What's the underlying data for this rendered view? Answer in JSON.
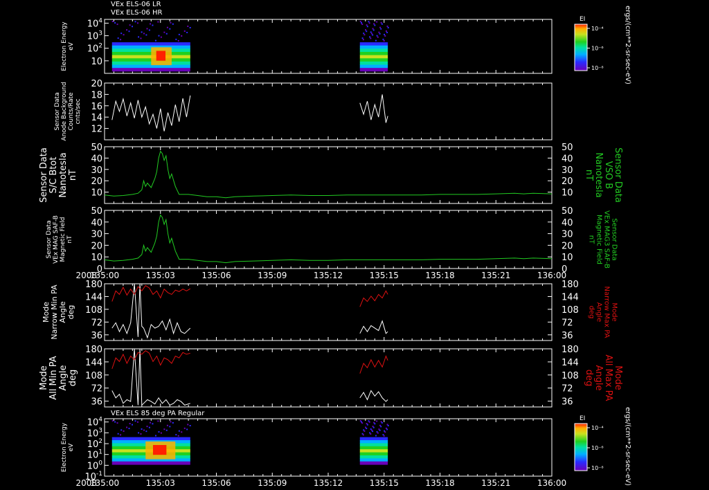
{
  "header": {
    "line1": "VEx ELS-06 LR",
    "line2": "VEx ELS-06 HR",
    "panel7_title": "VEx ELS 85 deg PA Regular"
  },
  "colorbar": {
    "label": "EI",
    "ticks": [
      "10⁻⁴",
      "10⁻⁶",
      "10⁻⁸"
    ],
    "units": "ergs/(cm**2-sr-sec-eV)"
  },
  "time_axis": {
    "year": "2008",
    "ticks": [
      "135:00",
      "135:03",
      "135:06",
      "135:09",
      "135:12",
      "135:15",
      "135:18",
      "135:21",
      "136:00"
    ]
  },
  "colors": {
    "background": "#000000",
    "axis": "#ffffff",
    "white_trace": "#ffffff",
    "green_trace": "#22cc22",
    "red_trace": "#dd1111",
    "spectrogram_palette": [
      "#6a00b8",
      "#2a2aff",
      "#00b0ff",
      "#00e0a0",
      "#20d020",
      "#c8e020",
      "#ffb000",
      "#ff2000"
    ]
  },
  "chart_data": [
    {
      "type": "heatmap",
      "panel": 1,
      "ylabel_lines": [
        "Electron Energy",
        "eV"
      ],
      "yscale": "log",
      "ylim": [
        1,
        20000
      ],
      "ytick_labels": [
        {
          "value": 10,
          "mant": "10",
          "exp": ""
        },
        {
          "value": 100,
          "mant": "10",
          "exp": "2"
        },
        {
          "value": 1000,
          "mant": "10",
          "exp": "3"
        },
        {
          "value": 10000,
          "mant": "10",
          "exp": "4"
        }
      ],
      "data_intervals_min": [
        [
          0.4,
          4.6
        ],
        [
          13.7,
          15.2
        ]
      ],
      "peak_intervals_min": [
        [
          2.5,
          3.6
        ]
      ]
    },
    {
      "type": "line",
      "panel": 2,
      "ylabel_lines": [
        "Sensor Data",
        "Anode Background",
        "Counts/Rate",
        "cnts/sec"
      ],
      "ylim": [
        10,
        20
      ],
      "yticks": [
        12,
        14,
        16,
        18,
        20
      ],
      "series": [
        {
          "color": "white",
          "segments": [
            {
              "x": [
                0.4,
                0.6,
                0.8,
                1.0,
                1.2,
                1.4,
                1.6,
                1.8,
                2.0,
                2.2,
                2.4,
                2.6,
                2.8,
                3.0,
                3.2,
                3.4,
                3.6,
                3.8,
                4.0,
                4.2,
                4.4,
                4.6
              ],
              "y": [
                13.5,
                16.8,
                15.0,
                17.2,
                14.2,
                16.5,
                13.8,
                17.0,
                14.0,
                15.8,
                12.8,
                14.5,
                12.0,
                15.5,
                11.5,
                14.8,
                12.5,
                16.2,
                13.2,
                17.3,
                14.0,
                17.8
              ]
            },
            {
              "x": [
                13.7,
                13.9,
                14.1,
                14.3,
                14.5,
                14.7,
                14.9,
                15.1,
                15.2
              ],
              "y": [
                16.5,
                14.5,
                16.8,
                13.5,
                16.2,
                14.0,
                18.0,
                13.0,
                14.2
              ]
            }
          ]
        }
      ]
    },
    {
      "type": "line",
      "panel": 3,
      "ylabel_lines": [
        "Sensor Data",
        "S/C Btot",
        "Nanotesla",
        "nT"
      ],
      "ylabel_right_lines": [
        "Sensor Data",
        "VSO B",
        "Nanotesla",
        "nT"
      ],
      "ylim": [
        0,
        50
      ],
      "yticks": [
        10,
        20,
        30,
        40,
        50
      ],
      "series": [
        {
          "color": "green",
          "segments": [
            {
              "x": [
                0,
                0.5,
                1.0,
                1.5,
                1.8,
                2.0,
                2.1,
                2.2,
                2.3,
                2.5,
                2.7,
                2.8,
                2.9,
                3.0,
                3.1,
                3.2,
                3.3,
                3.4,
                3.5,
                3.6,
                3.8,
                4.0,
                4.5,
                5.0,
                5.5,
                6.0,
                6.5,
                7.0,
                8.0,
                9.0,
                10,
                11,
                12,
                13,
                14,
                15,
                16,
                17,
                18,
                19,
                20,
                21,
                22,
                22.5,
                23,
                24
              ],
              "y": [
                7.5,
                6.5,
                7.0,
                8.0,
                9.0,
                12,
                20,
                15,
                18,
                14,
                22,
                28,
                40,
                46,
                44,
                38,
                42,
                30,
                22,
                26,
                15,
                8,
                8,
                7,
                6,
                6,
                5,
                6,
                6.5,
                7,
                7.5,
                7,
                7,
                7.5,
                7.5,
                7.5,
                7.5,
                7.5,
                8,
                8,
                8,
                8.5,
                9,
                8.5,
                9,
                8.5
              ]
            }
          ]
        }
      ]
    },
    {
      "type": "line",
      "panel": 4,
      "ylabel_lines": [
        "Sensor Data",
        "VEx MAG SAF-B",
        "Magnetic Field",
        "nT"
      ],
      "ylabel_right_lines": [
        "Sensor Data",
        "VEx MAG3 SAF-B",
        "Magnetic Field",
        "nT"
      ],
      "ylim": [
        0,
        50
      ],
      "yticks": [
        0,
        10,
        20,
        30,
        40,
        50
      ],
      "series": [
        {
          "color": "green",
          "segments": [
            {
              "x": [
                0,
                0.5,
                1.0,
                1.5,
                1.8,
                2.0,
                2.1,
                2.2,
                2.3,
                2.5,
                2.7,
                2.8,
                2.9,
                3.0,
                3.1,
                3.2,
                3.3,
                3.4,
                3.5,
                3.6,
                3.8,
                4.0,
                4.5,
                5.0,
                5.5,
                6.0,
                6.5,
                7.0,
                8.0,
                9.0,
                10,
                11,
                12,
                13,
                14,
                15,
                16,
                17,
                18,
                19,
                20,
                21,
                22,
                22.5,
                23,
                24
              ],
              "y": [
                7.5,
                6.5,
                7.0,
                8.0,
                9.0,
                12,
                20,
                15,
                18,
                14,
                22,
                28,
                40,
                46,
                44,
                38,
                42,
                30,
                22,
                26,
                15,
                8,
                8,
                7,
                6,
                6,
                5,
                6,
                6.5,
                7,
                7.5,
                7,
                7,
                7.5,
                7.5,
                7.5,
                7.5,
                7.5,
                8,
                8,
                8,
                8.5,
                9,
                8.5,
                9,
                8.5
              ]
            }
          ]
        }
      ]
    },
    {
      "type": "line",
      "panel": 5,
      "ylabel_lines": [
        "Mode",
        "Narrow Min PA",
        "Angle",
        "deg"
      ],
      "ylabel_right_lines": [
        "Mode",
        "Narrow Max PA",
        "Angle",
        "deg"
      ],
      "ylim": [
        20,
        180
      ],
      "yticks": [
        36,
        72,
        108,
        144,
        180
      ],
      "series": [
        {
          "color": "white",
          "segments": [
            {
              "x": [
                0.4,
                0.6,
                0.8,
                1.0,
                1.2,
                1.4,
                1.6,
                1.8,
                1.9,
                2.0,
                2.1,
                2.3,
                2.5,
                2.7,
                2.9,
                3.1,
                3.3,
                3.5,
                3.7,
                3.9,
                4.1,
                4.3,
                4.6
              ],
              "y": [
                55,
                70,
                45,
                65,
                40,
                70,
                180,
                30,
                180,
                60,
                55,
                28,
                65,
                55,
                60,
                75,
                50,
                80,
                40,
                70,
                45,
                40,
                55
              ]
            },
            {
              "x": [
                13.7,
                13.9,
                14.1,
                14.3,
                14.5,
                14.7,
                14.9,
                15.1,
                15.2
              ],
              "y": [
                40,
                60,
                45,
                62,
                55,
                48,
                75,
                40,
                45
              ]
            }
          ]
        },
        {
          "color": "red",
          "segments": [
            {
              "x": [
                0.4,
                0.6,
                0.8,
                1.0,
                1.2,
                1.4,
                1.6,
                1.8,
                2.0,
                2.2,
                2.4,
                2.6,
                2.8,
                3.0,
                3.2,
                3.4,
                3.6,
                3.8,
                4.0,
                4.2,
                4.4,
                4.6
              ],
              "y": [
                130,
                160,
                150,
                170,
                148,
                165,
                150,
                172,
                160,
                175,
                168,
                150,
                160,
                140,
                165,
                155,
                150,
                162,
                158,
                165,
                160,
                166
              ]
            },
            {
              "x": [
                13.7,
                13.9,
                14.1,
                14.3,
                14.5,
                14.7,
                14.9,
                15.1,
                15.2
              ],
              "y": [
                115,
                140,
                130,
                145,
                132,
                150,
                140,
                160,
                150
              ]
            }
          ]
        }
      ]
    },
    {
      "type": "line",
      "panel": 6,
      "ylabel_lines": [
        "Mode",
        "All Min PA",
        "Angle",
        "deg"
      ],
      "ylabel_right_lines": [
        "Mode",
        "All Max PA",
        "Angle",
        "deg"
      ],
      "ylim": [
        20,
        180
      ],
      "yticks": [
        36,
        72,
        108,
        144,
        180
      ],
      "series": [
        {
          "color": "white",
          "segments": [
            {
              "x": [
                0.4,
                0.6,
                0.8,
                1.0,
                1.2,
                1.4,
                1.6,
                1.8,
                1.9,
                2.0,
                2.1,
                2.3,
                2.5,
                2.7,
                2.9,
                3.1,
                3.3,
                3.5,
                3.7,
                3.9,
                4.1,
                4.3,
                4.6
              ],
              "y": [
                65,
                45,
                55,
                30,
                40,
                35,
                180,
                25,
                180,
                25,
                30,
                40,
                35,
                28,
                45,
                30,
                40,
                25,
                30,
                40,
                35,
                25,
                30
              ]
            },
            {
              "x": [
                13.7,
                13.9,
                14.1,
                14.3,
                14.5,
                14.7,
                14.9,
                15.1,
                15.2
              ],
              "y": [
                45,
                60,
                40,
                65,
                50,
                62,
                45,
                35,
                40
              ]
            }
          ]
        },
        {
          "color": "red",
          "segments": [
            {
              "x": [
                0.4,
                0.6,
                0.8,
                1.0,
                1.2,
                1.4,
                1.6,
                1.8,
                2.0,
                2.2,
                2.4,
                2.6,
                2.8,
                3.0,
                3.2,
                3.4,
                3.6,
                3.8,
                4.0,
                4.2,
                4.4,
                4.6
              ],
              "y": [
                125,
                155,
                145,
                165,
                140,
                160,
                150,
                170,
                165,
                175,
                168,
                145,
                160,
                135,
                155,
                150,
                140,
                160,
                155,
                170,
                165,
                168
              ]
            },
            {
              "x": [
                13.7,
                13.9,
                14.1,
                14.3,
                14.5,
                14.7,
                14.9,
                15.1,
                15.2
              ],
              "y": [
                112,
                140,
                128,
                150,
                130,
                148,
                130,
                160,
                148
              ]
            }
          ]
        }
      ]
    },
    {
      "type": "heatmap",
      "panel": 7,
      "ylabel_lines": [
        "Electron Energy",
        "eV"
      ],
      "yscale": "log",
      "ylim": [
        0.1,
        20000
      ],
      "ytick_labels": [
        {
          "value": 0.1,
          "mant": "10",
          "exp": "-1"
        },
        {
          "value": 1,
          "mant": "10",
          "exp": "0"
        },
        {
          "value": 10,
          "mant": "10",
          "exp": "1"
        },
        {
          "value": 100,
          "mant": "10",
          "exp": "2"
        },
        {
          "value": 1000,
          "mant": "10",
          "exp": "3"
        },
        {
          "value": 10000,
          "mant": "10",
          "exp": "4"
        }
      ],
      "data_intervals_min": [
        [
          0.4,
          4.6
        ],
        [
          13.7,
          15.2
        ]
      ],
      "peak_intervals_min": [
        [
          2.2,
          3.8
        ]
      ]
    }
  ]
}
